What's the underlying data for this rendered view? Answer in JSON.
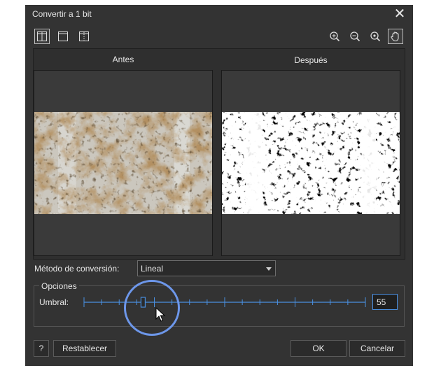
{
  "window": {
    "title": "Convertir a 1 bit"
  },
  "toolbar": {
    "views": [
      "split-view-icon",
      "single-view-icon",
      "compare-view-icon"
    ],
    "tools": [
      "zoom-in-icon",
      "zoom-out-icon",
      "zoom-fit-icon",
      "pan-hand-icon"
    ]
  },
  "preview": {
    "before_label": "Antes",
    "after_label": "Después"
  },
  "method": {
    "label": "Método de conversión:",
    "value": "Lineal"
  },
  "options": {
    "legend": "Opciones",
    "threshold_label": "Umbral:",
    "threshold_value": "55",
    "threshold_fraction": 0.21
  },
  "buttons": {
    "help": "?",
    "reset": "Restablecer",
    "ok": "OK",
    "cancel": "Cancelar"
  },
  "colors": {
    "accent": "#4a90e2",
    "highlight": "#6d97ea",
    "dialog_bg": "#333333"
  }
}
